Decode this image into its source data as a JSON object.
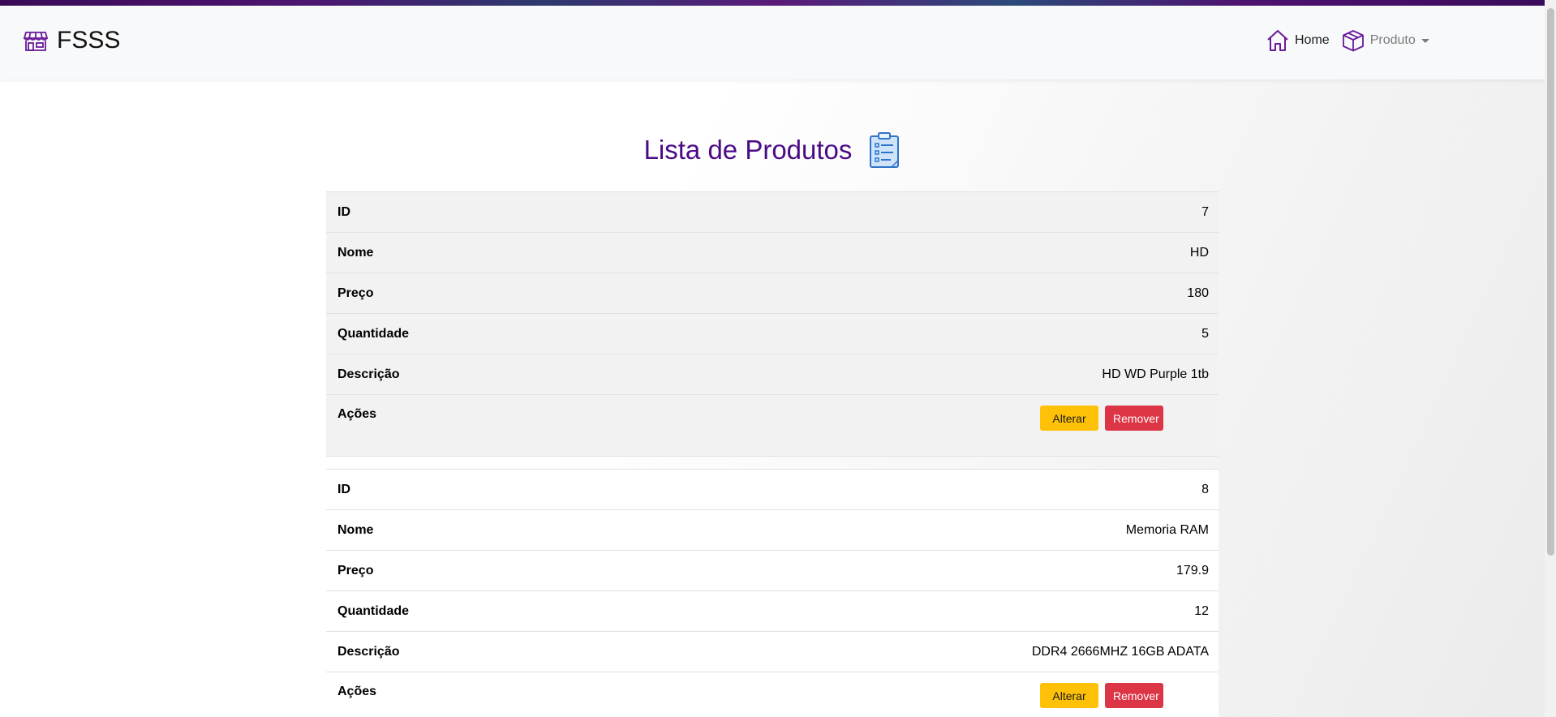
{
  "brand": {
    "name": "FSSS",
    "icon": "store-icon"
  },
  "nav": {
    "home_label": "Home",
    "home_icon": "house-icon",
    "product_label": "Produto",
    "product_icon": "box-icon"
  },
  "page": {
    "title": "Lista de Produtos",
    "title_icon": "clipboard-list-icon"
  },
  "labels": {
    "id": "ID",
    "nome": "Nome",
    "preco": "Preço",
    "quantidade": "Quantidade",
    "descricao": "Descrição",
    "acoes": "Ações",
    "alterar": "Alterar",
    "remover": "Remover"
  },
  "products": [
    {
      "id": "7",
      "nome": "HD",
      "preco": "180",
      "quantidade": "5",
      "descricao": "HD WD Purple 1tb"
    },
    {
      "id": "8",
      "nome": "Memoria RAM",
      "preco": "179.9",
      "quantidade": "12",
      "descricao": "DDR4 2666MHZ 16GB ADATA"
    }
  ],
  "colors": {
    "brand_purple": "#4b0a86",
    "edit_button": "#ffc107",
    "remove_button": "#dc3545",
    "navbar_bg": "#f8f9fa"
  }
}
